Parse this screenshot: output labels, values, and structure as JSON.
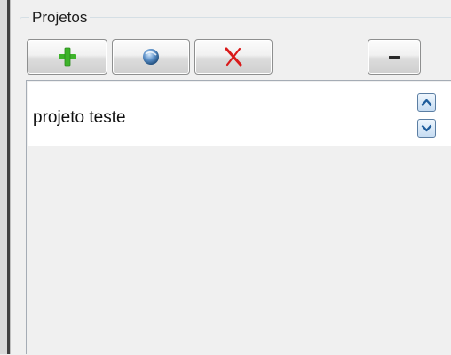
{
  "panel": {
    "title": "Projetos"
  },
  "toolbar": {
    "add": {
      "icon": "plus-icon",
      "color": "#3db32a"
    },
    "refresh": {
      "icon": "refresh-globe-icon",
      "color": "#4a7fb8"
    },
    "delete": {
      "icon": "x-delete-icon",
      "color": "#d91a1a"
    },
    "collapse": {
      "icon": "minus-icon"
    }
  },
  "list": {
    "items": [
      {
        "label": "projeto teste",
        "selected": true
      }
    ],
    "move_up_icon": "chevron-up-icon",
    "move_down_icon": "chevron-down-icon"
  }
}
